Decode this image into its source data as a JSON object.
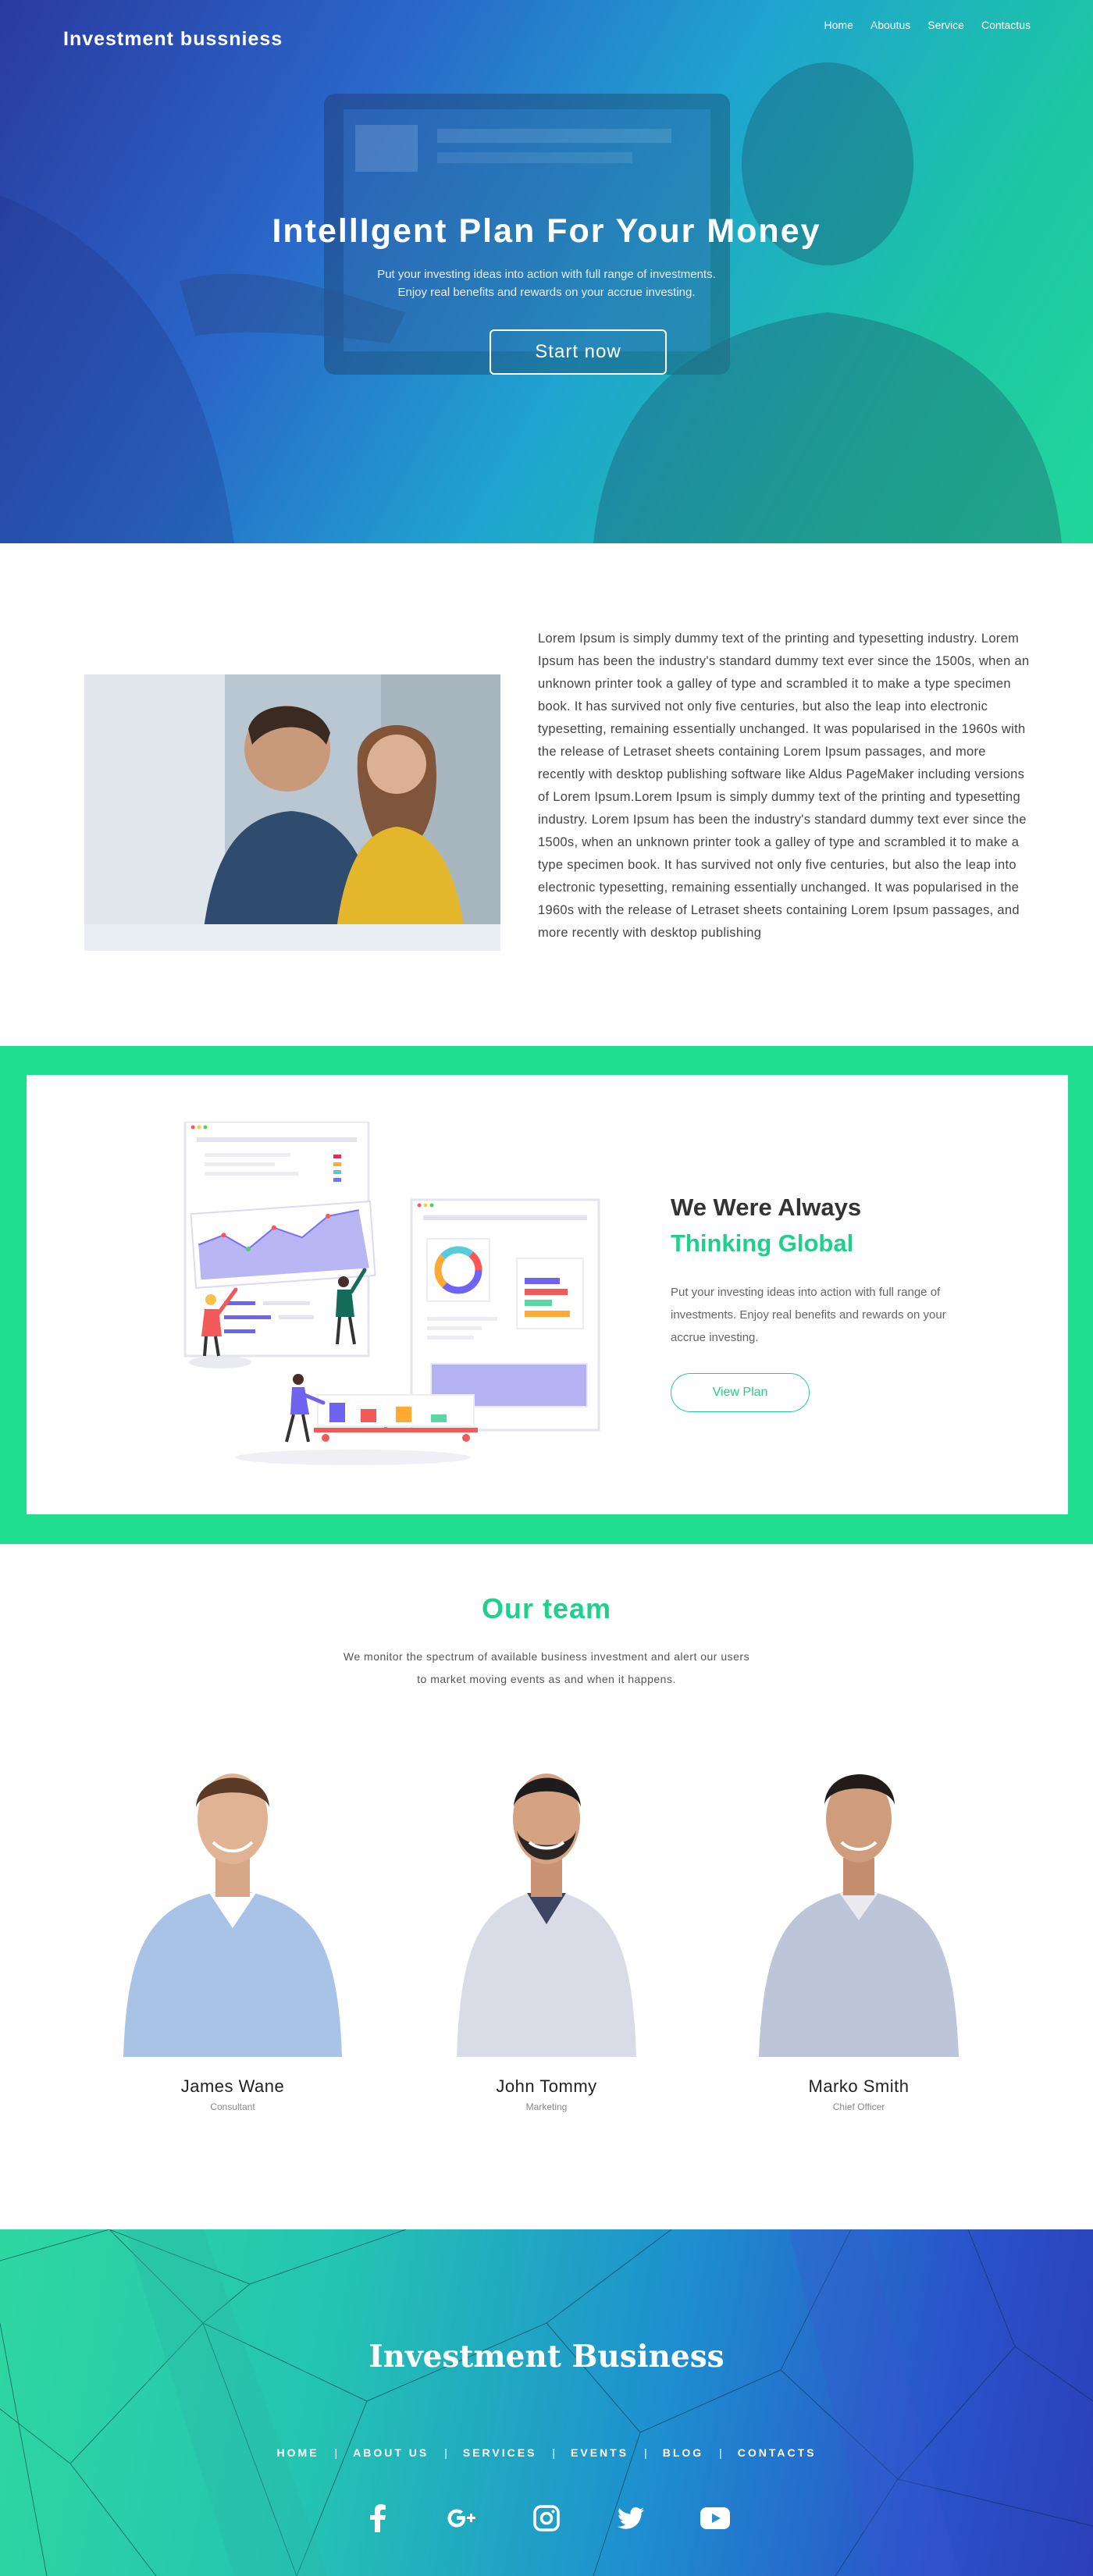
{
  "header": {
    "brand": "Investment bussniess",
    "nav": [
      "Home",
      "Aboutus",
      "Service",
      "Contactus"
    ]
  },
  "hero": {
    "title": "IntellIgent Plan For Your Money",
    "subtitle_line1": "Put your investing ideas into action with full range of investments.",
    "subtitle_line2": "Enjoy real benefits and rewards on your accrue investing.",
    "cta": "Start now"
  },
  "about": {
    "text": "Lorem Ipsum is simply dummy text of the printing and typesetting industry. Lorem Ipsum has been the industry's standard dummy text ever since the 1500s, when an unknown printer took a galley of type and scrambled it to make a type specimen book. It has survived not only five centuries, but also the leap into electronic typesetting, remaining essentially unchanged. It was popularised in the 1960s with the release of Letraset sheets containing Lorem Ipsum passages, and more recently with desktop publishing software like Aldus PageMaker including versions of Lorem Ipsum.Lorem Ipsum is simply dummy text of the printing and typesetting industry. Lorem Ipsum has been the industry's standard dummy text ever since the 1500s, when an unknown printer took a galley of type and scrambled it to make a type specimen book. It has survived not only five centuries, but also the leap into electronic typesetting, remaining essentially unchanged. It was popularised in the 1960s with the release of Letraset sheets containing Lorem Ipsum passages, and more recently with desktop publishing"
  },
  "global": {
    "title_line1": "We Were Always",
    "title_line2": "Thinking Global",
    "text": "Put your investing ideas into action with full range of investments. Enjoy real benefits and rewards on your accrue investing.",
    "cta": "View Plan"
  },
  "team": {
    "title": "Our team",
    "subtitle_line1": "We monitor the spectrum of available business investment and alert our users",
    "subtitle_line2": "to market moving events as and when it happens.",
    "members": [
      {
        "name": "James Wane",
        "role": "Consultant"
      },
      {
        "name": "John Tommy",
        "role": "Marketing"
      },
      {
        "name": "Marko Smith",
        "role": "Chief Officer"
      }
    ]
  },
  "footer": {
    "brand": "Investment Business",
    "nav": [
      "HOME",
      "ABOUT US",
      "SERVICES",
      "EVENTS",
      "BLOG",
      "CONTACTS"
    ],
    "social_icons": [
      "facebook-icon",
      "google-plus-icon",
      "instagram-icon",
      "twitter-icon",
      "youtube-icon"
    ]
  },
  "colors": {
    "accent_green": "#1fde8f",
    "accent_text_green": "#1fcf8c",
    "hero_blue": "#2a3aa0",
    "hero_teal": "#22d69a"
  }
}
